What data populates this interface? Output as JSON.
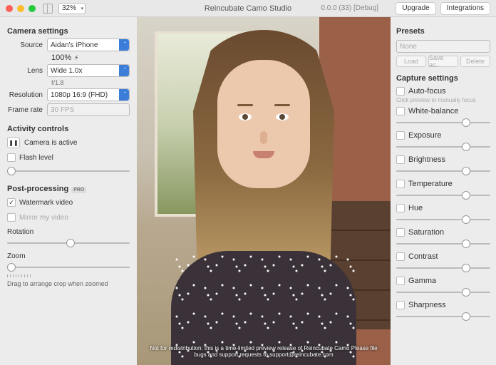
{
  "titlebar": {
    "zoom": "32%",
    "title": "Reincubate Camo Studio",
    "version": "0.0.0 (33) [Debug]",
    "upgrade": "Upgrade",
    "integrations": "Integrations"
  },
  "left": {
    "camera_settings": "Camera settings",
    "source_label": "Source",
    "source_value": "Aidan's iPhone",
    "source_sub": "100%",
    "usb": "⚡︎",
    "lens_label": "Lens",
    "lens_value": "Wide 1.0x",
    "lens_sub": "f/1.8",
    "resolution_label": "Resolution",
    "resolution_value": "1080p 16:9 (FHD)",
    "framerate_label": "Frame rate",
    "framerate_value": "30 FPS",
    "activity": "Activity controls",
    "active": "Camera is active",
    "flash": "Flash level",
    "post": "Post-processing",
    "pro": "PRO",
    "watermark": "Watermark video",
    "mirror": "Mirror my video",
    "rotation": "Rotation",
    "zoom": "Zoom",
    "drag_hint": "Drag to arrange crop when zoomed"
  },
  "right": {
    "presets": "Presets",
    "preset_value": "None",
    "load": "Load",
    "saveas": "Save as...",
    "delete": "Delete",
    "capture": "Capture settings",
    "autofocus": "Auto-focus",
    "af_hint": "Click preview to manually focus",
    "items": [
      "White-balance",
      "Exposure",
      "Brightness",
      "Temperature",
      "Hue",
      "Saturation",
      "Contrast",
      "Gamma",
      "Sharpness"
    ]
  },
  "watermark": "Not for redistribution: this is a time-limited preview release of Reincubate Camo\nPlease file bugs and support requests to support@reincubate.com"
}
